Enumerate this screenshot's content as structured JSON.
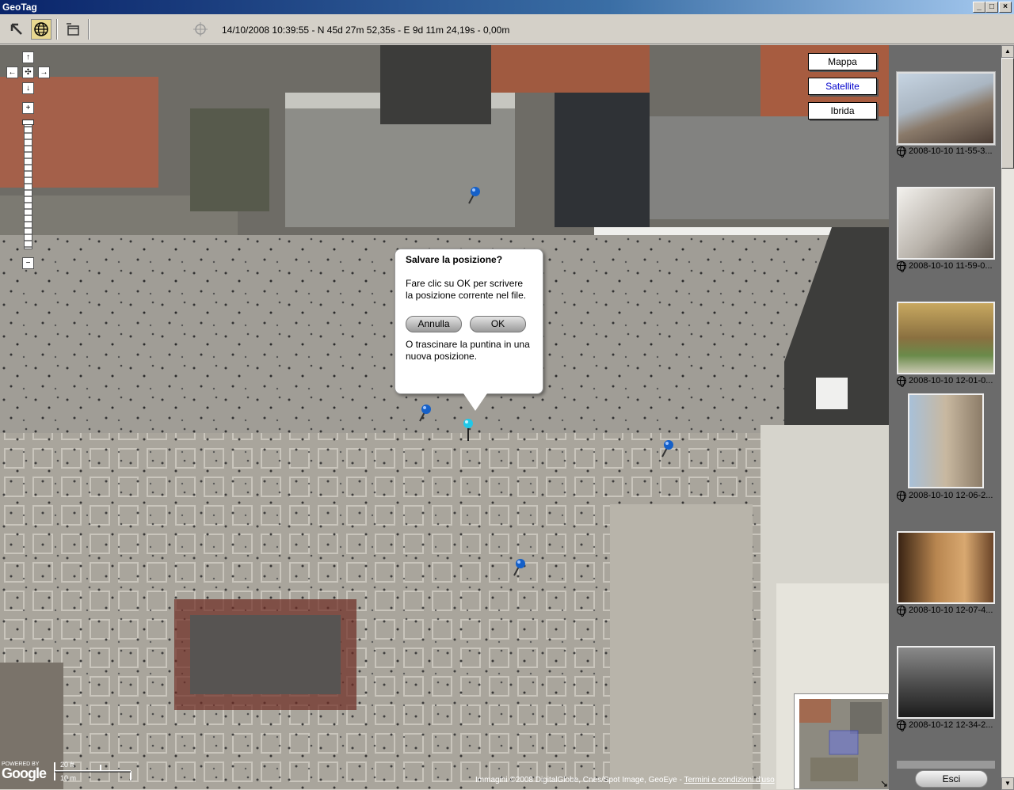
{
  "window": {
    "title": "GeoTag",
    "minimize_label": "_",
    "maximize_label": "□",
    "close_label": "×"
  },
  "toolbar": {
    "tools": [
      {
        "name": "pointer-tool-icon"
      },
      {
        "name": "geotag-globe-icon"
      },
      {
        "name": "window-tool-icon"
      },
      {
        "name": "crosshair-target-icon"
      }
    ],
    "status": "14/10/2008 10:39:55 - N 45d 27m 52,35s - E 9d 11m 24,19s - 0,00m"
  },
  "map": {
    "type_buttons": [
      {
        "label": "Mappa",
        "active": false
      },
      {
        "label": "Satellite",
        "active": true
      },
      {
        "label": "Ibrida",
        "active": false
      }
    ],
    "nav": {
      "up": "↑",
      "left": "←",
      "center": "✣",
      "right": "→",
      "down": "↓",
      "zoom_in": "+",
      "zoom_out": "−"
    },
    "dialog": {
      "title": "Salvare la posizione?",
      "message": "Fare clic su OK per scrivere la posizione corrente nel file.",
      "cancel": "Annulla",
      "ok": "OK",
      "alt_text": "O trascinare la puntina in una nuova posizione."
    },
    "scale": {
      "imperial": "20 ft",
      "metric": "10 m"
    },
    "powered_by": "POWERED BY",
    "google": "Google",
    "copyright": "Immagini ©2008 DigitalGlobe, Cnes/Spot Image, GeoEye -",
    "terms": "Termini e condizioni d'uso"
  },
  "photos": [
    {
      "caption": "2008-10-10 11-55-3...",
      "colors": [
        "#b7c6d6",
        "#6f5a4a"
      ]
    },
    {
      "caption": "2008-10-10 11-59-0...",
      "colors": [
        "#e8e6e2",
        "#7a7068"
      ]
    },
    {
      "caption": "2008-10-10 12-01-0...",
      "colors": [
        "#b49a5a",
        "#5b6a3f"
      ]
    },
    {
      "caption": "2008-10-10 12-06-2...",
      "colors": [
        "#9fb6d0",
        "#9c8c78"
      ]
    },
    {
      "caption": "2008-10-10 12-07-4...",
      "colors": [
        "#c49055",
        "#5a3a20"
      ]
    },
    {
      "caption": "2008-10-12 12-34-2...",
      "colors": [
        "#707070",
        "#2a2a2a"
      ]
    }
  ],
  "exit_label": "Esci"
}
